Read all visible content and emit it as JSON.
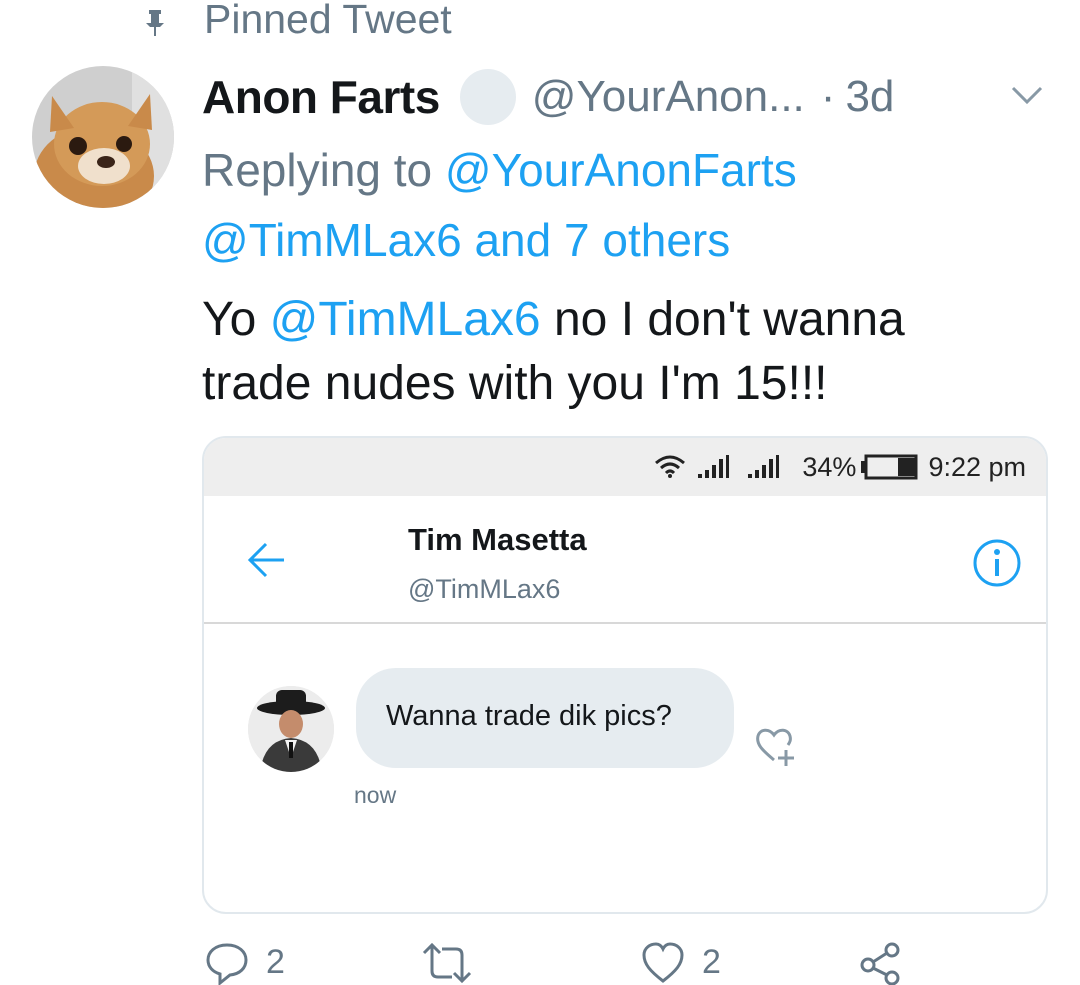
{
  "pinned": {
    "label": "Pinned Tweet",
    "icon": "pin-icon"
  },
  "tweet": {
    "display_name": "Anon Farts",
    "handle": "@YourAnon...",
    "separator": "·",
    "time": "3d",
    "replying_prefix": "Replying to ",
    "replying_to_1": "@YourAnonFarts",
    "replying_to_2": "@TimMLax6 and 7 others",
    "text_1": "Yo ",
    "text_mention": "@TimMLax6",
    "text_2": " no I don't wanna",
    "text_3": "trade nudes with you I'm 15!!!"
  },
  "screenshot": {
    "status_bar": {
      "battery_percent": "34%",
      "clock": "9:22 pm"
    },
    "dm_header": {
      "name": "Tim Masetta",
      "handle": "@TimMLax6"
    },
    "message": {
      "text": "Wanna trade dik pics?",
      "time": "now"
    }
  },
  "actions": {
    "reply_count": "2",
    "like_count": "2"
  },
  "colors": {
    "accent": "#1da1f2",
    "muted": "#657786",
    "text": "#14171a",
    "bubble": "#e6ecf0"
  }
}
